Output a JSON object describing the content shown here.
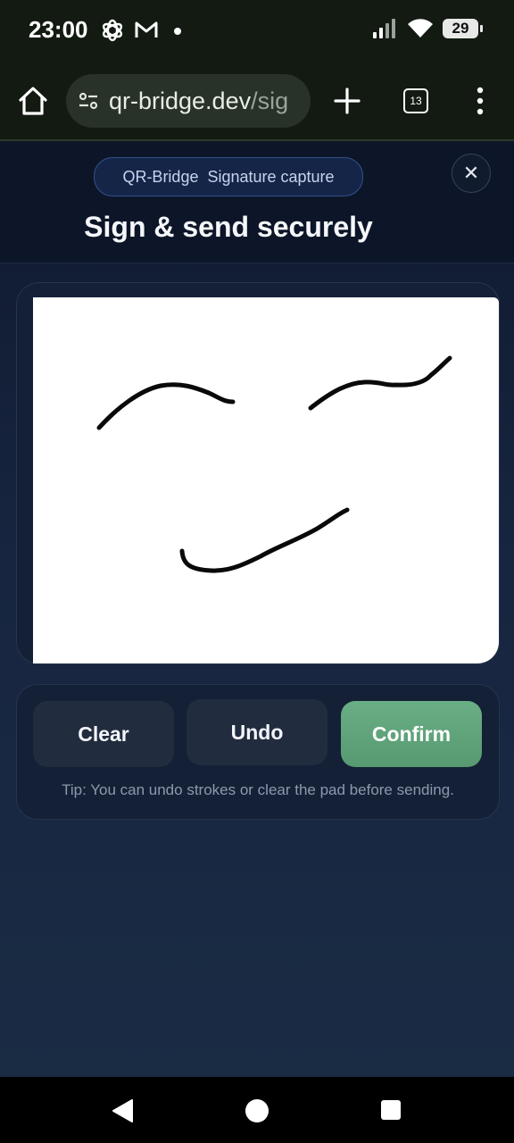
{
  "status_bar": {
    "time": "23:00",
    "battery": "29",
    "icons": [
      "openai-icon",
      "gmail-icon",
      "dot-icon",
      "signal-icon",
      "wifi-icon",
      "battery-icon"
    ]
  },
  "browser": {
    "url_host": "qr-bridge.dev",
    "url_path": "/sig",
    "tab_count": "13"
  },
  "header": {
    "badge_brand": "QR-Bridge",
    "badge_label": "Signature capture",
    "title": "Sign & send securely"
  },
  "actions": {
    "clear_label": "Clear",
    "undo_label": "Undo",
    "confirm_label": "Confirm",
    "tip": "Tip: You can undo strokes or clear the pad before sending."
  },
  "colors": {
    "accent_confirm": "#62a77c",
    "page_bg": "#172540",
    "pad_bg": "#ffffff"
  }
}
